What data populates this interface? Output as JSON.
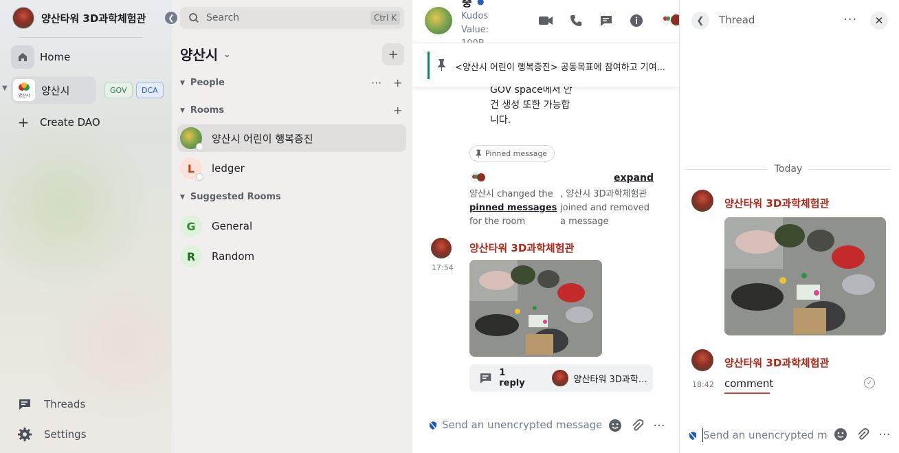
{
  "account": {
    "name": "양산타워 3D과학체험관"
  },
  "nav": {
    "home_label": "Home",
    "dao": {
      "label": "양산시",
      "logo_text": "양산시",
      "badges": [
        "GOV",
        "DCA"
      ]
    },
    "create_label": "Create DAO",
    "threads_label": "Threads",
    "settings_label": "Settings"
  },
  "room_list": {
    "search_placeholder": "Search",
    "search_shortcut": "Ctrl K",
    "space_title": "양산시",
    "sections": {
      "people": "People",
      "rooms": "Rooms",
      "suggested": "Suggested Rooms"
    },
    "rooms": [
      {
        "label": "양산시 어린이 행복증진",
        "initial": ""
      },
      {
        "label": "ledger",
        "initial": "L"
      }
    ],
    "suggested": [
      {
        "label": "General",
        "initial": "G"
      },
      {
        "label": "Random",
        "initial": "R"
      }
    ]
  },
  "timeline": {
    "header": {
      "title_fragment": "중",
      "kudos_line1": "Kudos",
      "kudos_line2": "Value:",
      "kudos_line3": "100B"
    },
    "pinned_text": "<양산시 어린이 행복증진> 공동목표에 참여하고 기여...",
    "message_tail": [
      "GOV space에서 안",
      "건 생성 또한 가능합",
      "니다."
    ],
    "pinned_chip": "Pinned message",
    "expand_label": "expand",
    "state_left_prefix": "양산시 changed the",
    "state_left_link": "pinned messages",
    "state_left_suffix": "for the room",
    "state_right": ", 양산시 3D과학체험관 joined and removed a message",
    "sender": "양산타워 3D과학체험관",
    "time": "17:54",
    "thread_summary": {
      "count": "1 reply",
      "name": "양산타워 3D과학체..."
    },
    "composer_placeholder": "Send an unencrypted message..."
  },
  "thread": {
    "title": "Thread",
    "today_label": "Today",
    "root_sender": "양산타워 3D과학체험관",
    "reply_sender": "양산타워 3D과학체험관",
    "reply_time": "18:42",
    "reply_text": "comment",
    "composer_placeholder": "Send an unencrypted message..."
  },
  "colors": {
    "sender_name": "#b02a1a",
    "pinned_accent": "#0f8a5f",
    "gov_badge": "#2f7a4b",
    "dca_badge": "#2a5dba"
  }
}
